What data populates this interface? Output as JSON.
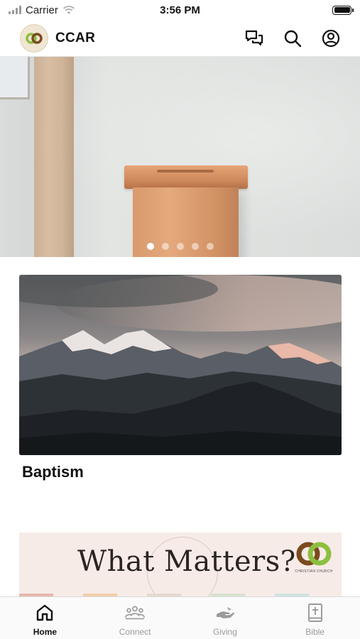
{
  "status_bar": {
    "carrier": "Carrier",
    "time": "3:56 PM",
    "icons": [
      "signal-icon",
      "wifi-icon",
      "battery-icon"
    ]
  },
  "header": {
    "title": "CCAR",
    "logo_icon": "church-logo-icon",
    "actions": [
      {
        "name": "messages",
        "icon": "chat-bubbles-icon"
      },
      {
        "name": "search",
        "icon": "search-icon"
      },
      {
        "name": "profile",
        "icon": "user-circle-icon"
      }
    ]
  },
  "hero": {
    "image": "wooden offering box on wall",
    "carousel_count": 5,
    "carousel_active_index": 0
  },
  "feed": {
    "card": {
      "image": "mountain range at dusk",
      "title": "Baptism"
    },
    "banner": {
      "headline": "What Matters?",
      "logo_text": "CHRISTIAN CHURCH"
    }
  },
  "tab_bar": {
    "tabs": [
      {
        "label": "Home",
        "icon": "home-icon",
        "active": true
      },
      {
        "label": "Connect",
        "icon": "people-icon",
        "active": false
      },
      {
        "label": "Giving",
        "icon": "giving-hand-icon",
        "active": false
      },
      {
        "label": "Bible",
        "icon": "bible-icon",
        "active": false
      }
    ]
  },
  "colors": {
    "accent_green": "#8cbf3f",
    "accent_brown": "#7a4a1f",
    "active_tab": "#111111",
    "inactive_tab": "#9a9a9a",
    "banner_bg": "#f7ebe7"
  }
}
